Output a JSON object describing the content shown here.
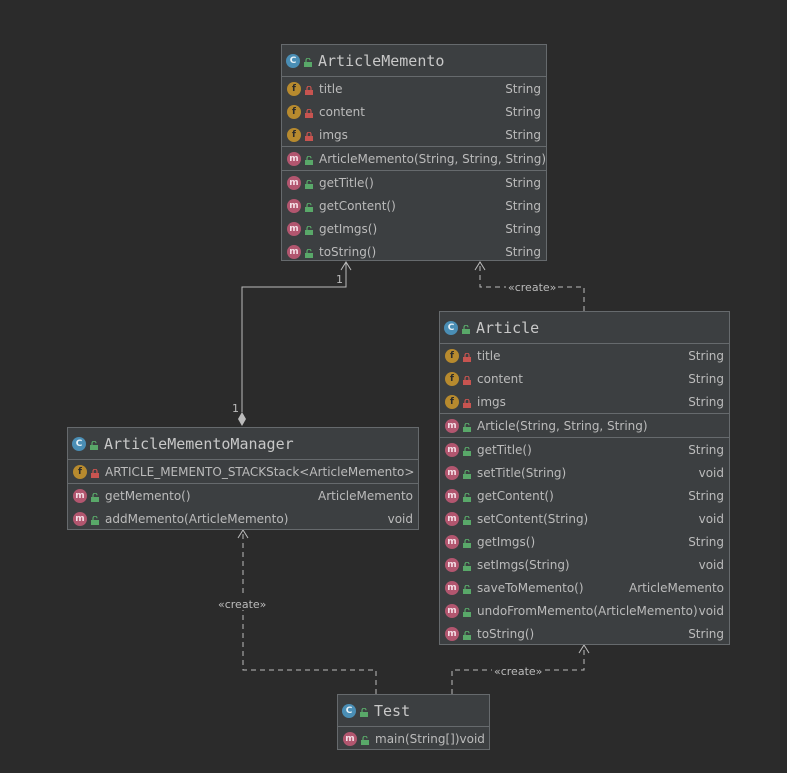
{
  "classes": {
    "article_memento": {
      "name": "ArticleMemento",
      "fields": [
        {
          "name": "title",
          "type": "String"
        },
        {
          "name": "content",
          "type": "String"
        },
        {
          "name": "imgs",
          "type": "String"
        }
      ],
      "constructors": [
        {
          "name": "ArticleMemento(String, String, String)",
          "type": ""
        }
      ],
      "methods": [
        {
          "name": "getTitle()",
          "type": "String"
        },
        {
          "name": "getContent()",
          "type": "String"
        },
        {
          "name": "getImgs()",
          "type": "String"
        },
        {
          "name": "toString()",
          "type": "String"
        }
      ]
    },
    "article": {
      "name": "Article",
      "fields": [
        {
          "name": "title",
          "type": "String"
        },
        {
          "name": "content",
          "type": "String"
        },
        {
          "name": "imgs",
          "type": "String"
        }
      ],
      "constructors": [
        {
          "name": "Article(String, String, String)",
          "type": ""
        }
      ],
      "methods": [
        {
          "name": "getTitle()",
          "type": "String"
        },
        {
          "name": "setTitle(String)",
          "type": "void"
        },
        {
          "name": "getContent()",
          "type": "String"
        },
        {
          "name": "setContent(String)",
          "type": "void"
        },
        {
          "name": "getImgs()",
          "type": "String"
        },
        {
          "name": "setImgs(String)",
          "type": "void"
        },
        {
          "name": "saveToMemento()",
          "type": "ArticleMemento"
        },
        {
          "name": "undoFromMemento(ArticleMemento)",
          "type": "void"
        },
        {
          "name": "toString()",
          "type": "String"
        }
      ]
    },
    "manager": {
      "name": "ArticleMementoManager",
      "fields": [
        {
          "name": "ARTICLE_MEMENTO_STACK",
          "type": "Stack<ArticleMemento>"
        }
      ],
      "methods": [
        {
          "name": "getMemento()",
          "type": "ArticleMemento"
        },
        {
          "name": "addMemento(ArticleMemento)",
          "type": "void"
        }
      ]
    },
    "test": {
      "name": "Test",
      "methods": [
        {
          "name": "main(String[])",
          "type": "void"
        }
      ]
    }
  },
  "relations": {
    "aggregation_one_top": "1",
    "aggregation_one_bottom": "1",
    "create_article_to_memento": "«create»",
    "create_test_to_manager": "«create»",
    "create_test_to_article": "«create»"
  },
  "icons": {
    "class_badge": "C",
    "field_badge": "f",
    "method_badge": "m",
    "lock_icon": "private-lock",
    "unlock_icon": "public-unlock"
  },
  "colors": {
    "background": "#2b2b2b",
    "box": "#3c3f41",
    "class_badge": "#4a8eb5",
    "field_badge": "#b78a2e",
    "method_badge": "#b2566f",
    "private_lock": "#c75450",
    "public_lock": "#59a869"
  }
}
